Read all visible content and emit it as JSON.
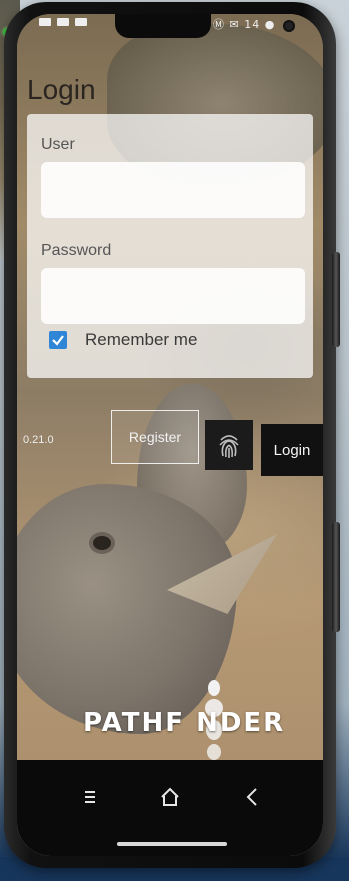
{
  "status_bar": {
    "right_text": "Ⓜ ✉ 14 ●"
  },
  "login": {
    "title": "Login",
    "user_label": "User",
    "user_value": "",
    "password_label": "Password",
    "password_value": "",
    "remember_label": "Remember me",
    "remember_checked": true
  },
  "actions": {
    "version": "0.21.0",
    "register_label": "Register",
    "fingerprint_icon": "fingerprint-icon",
    "login_label": "Login"
  },
  "brand": {
    "name": "PATHF NDER"
  },
  "nav": {
    "recent_icon": "recent-apps-icon",
    "home_icon": "home-icon",
    "back_icon": "back-icon"
  },
  "colors": {
    "accent_checkbox": "#2f86d6",
    "login_button": "#111111",
    "nav_bar": "#0a0a0a"
  }
}
